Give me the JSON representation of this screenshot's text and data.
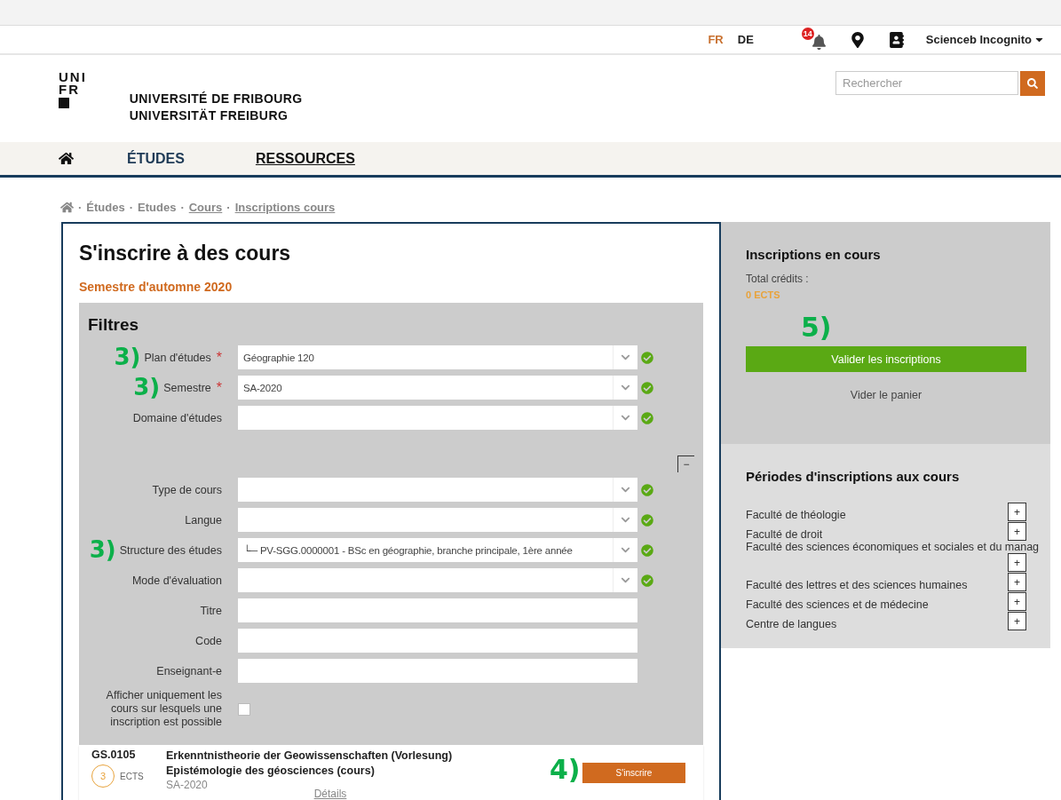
{
  "top_bar": {
    "languages": [
      {
        "label": "FR",
        "selected": true
      },
      {
        "label": "DE",
        "selected": false
      }
    ],
    "notification_count": "14",
    "user": "Scienceb Incognito"
  },
  "header": {
    "logo_lines": [
      "UNI",
      "FR"
    ],
    "university_names": [
      "UNIVERSITÉ DE FRIBOURG",
      "UNIVERSITÄT FREIBURG"
    ],
    "search": {
      "placeholder": "Rechercher"
    }
  },
  "nav": {
    "items": [
      {
        "label": "ÉTUDES",
        "selected": false
      },
      {
        "label": "RESSOURCES",
        "selected": true
      }
    ]
  },
  "breadcrumb": [
    {
      "separator": "·",
      "label": "Études",
      "link": false
    },
    {
      "separator": "·",
      "label": "Etudes",
      "link": false
    },
    {
      "separator": "·",
      "label": "Cours",
      "link": true
    },
    {
      "separator": "·",
      "label": "Inscriptions cours",
      "link": true
    }
  ],
  "main": {
    "title": "S'inscrire à des cours",
    "semester": "Semestre d'automne 2020",
    "filters": {
      "title": "Filtres",
      "collapse_button": "−",
      "fields": [
        {
          "kind": "select",
          "label": "Plan d'études",
          "required_mark": "*",
          "value": "Géographie  120",
          "annotation": "3)"
        },
        {
          "kind": "select",
          "label": "Semestre",
          "required_mark": "*",
          "value": "SA-2020",
          "annotation": "3)"
        },
        {
          "kind": "select",
          "label": "Domaine d'études"
        },
        {
          "kind": "spacer"
        },
        {
          "kind": "select",
          "label": "Type de cours"
        },
        {
          "kind": "select",
          "label": "Langue"
        },
        {
          "kind": "select",
          "label": "Structure des études",
          "value": "└─ PV-SGG.0000001 - BSc en géographie, branche principale, 1ère année",
          "annotation": "3)"
        },
        {
          "kind": "select",
          "label": "Mode d'évaluation"
        },
        {
          "kind": "text",
          "label": "Titre"
        },
        {
          "kind": "text",
          "label": "Code"
        },
        {
          "kind": "text",
          "label": "Enseignant-e"
        }
      ],
      "checkbox": {
        "label": "Afficher uniquement les cours sur lesquels une inscription est possible",
        "checked": false
      }
    },
    "courses": [
      {
        "code": "GS.0105",
        "credits": "3",
        "credits_unit": "ECTS",
        "title_de": "Erkenntnistheorie der Geowissenschaften (Vorlesung)",
        "title_fr": "Epistémologie des géosciences (cours)",
        "semester": "SA-2020",
        "details": "Détails",
        "button": "S'inscrire",
        "annotation": "4)"
      }
    ]
  },
  "sidebar": {
    "cart": {
      "title": "Inscriptions en cours",
      "credits_label": "Total crédits :",
      "credits_value": "0 ECTS",
      "annotation": "5)",
      "validate_button": "Valider les inscriptions",
      "empty_link": "Vider le panier"
    },
    "periods": {
      "title": "Périodes d'inscriptions aux cours",
      "expand_label": "+",
      "items": [
        "Faculté de théologie",
        "Faculté de droit",
        "Faculté des sciences économiques et sociales et du manag",
        "Faculté des lettres et des sciences humaines",
        "Faculté des sciences et de médecine",
        "Centre de langues"
      ]
    }
  }
}
